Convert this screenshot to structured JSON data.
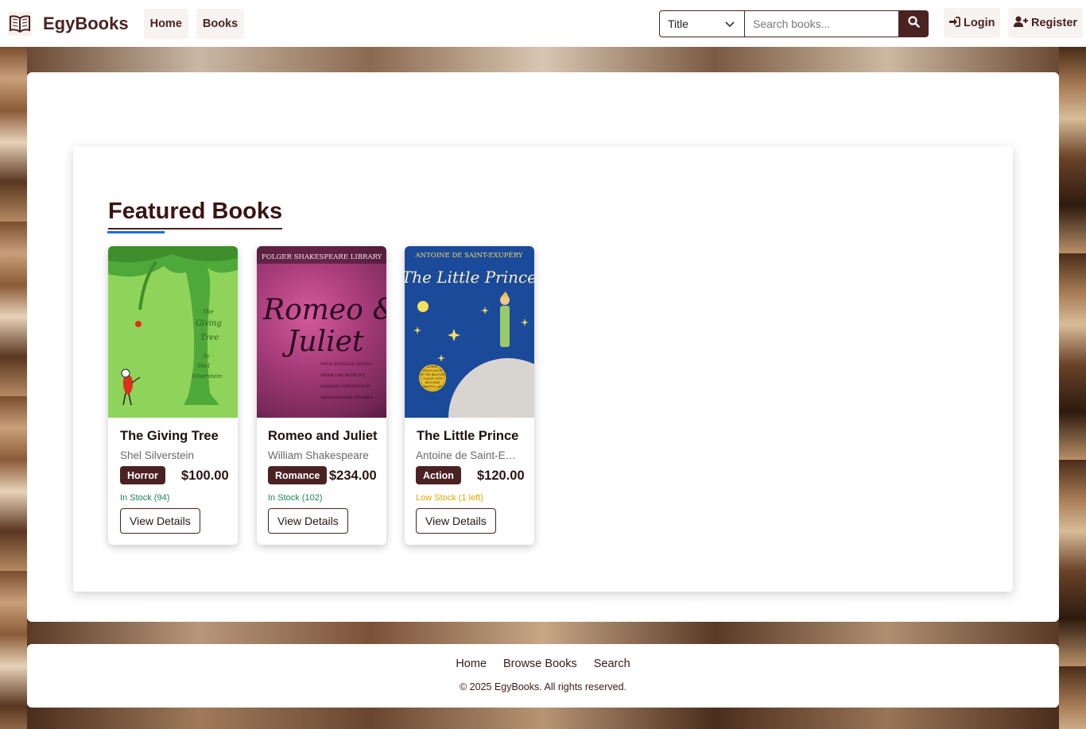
{
  "brand": {
    "name": "EgyBooks",
    "icon": "open-book-icon"
  },
  "nav": {
    "home": "Home",
    "books": "Books"
  },
  "search": {
    "field_selected": "Title",
    "placeholder": "Search books...",
    "icon": "search-icon"
  },
  "auth": {
    "login": "Login",
    "register": "Register",
    "login_icon": "sign-in-icon",
    "register_icon": "user-plus-icon"
  },
  "section": {
    "title": "Featured Books"
  },
  "books": [
    {
      "title": "The Giving Tree",
      "author": "Shel Silverstein",
      "genre": "Horror",
      "price": "$100.00",
      "stock": "In Stock (94)",
      "stock_color": "#198754",
      "action": "View Details"
    },
    {
      "title": "Romeo and Juliet",
      "author": "William Shakespeare",
      "genre": "Romance",
      "price": "$234.00",
      "stock": "In Stock (102)",
      "stock_color": "#198754",
      "action": "View Details"
    },
    {
      "title": "The Little Prince",
      "author": "Antoine de Saint-Exupéry",
      "genre": "Action",
      "price": "$120.00",
      "stock": "Low Stock (1 left)",
      "stock_color": "#e0a800",
      "action": "View Details"
    }
  ],
  "covers": {
    "giving_tree": {
      "lines": [
        "the",
        "Giving",
        "Tree",
        "by",
        "Shel",
        "Silverstein"
      ]
    },
    "romeo": {
      "publisher": "FOLGER SHAKESPEARE LIBRARY",
      "title_line1": "Romeo &",
      "title_line2": "Juliet",
      "notes": [
        "WITH DETAILED NOTES",
        "FROM THE WORLD'S",
        "LEADING CENTER FOR",
        "SHAKESPEARE STUDIES"
      ]
    },
    "prince": {
      "author": "ANTOINE DE SAINT-EXUPÉRY",
      "title": "The Little Prince",
      "seal": [
        "A NEW",
        "TRANSLATION",
        "OF THE BELOVED",
        "CLASSIC WITH",
        "RESTORED",
        "ORIGINAL ART"
      ]
    }
  },
  "footer": {
    "links": [
      "Home",
      "Browse Books",
      "Search"
    ],
    "copyright": "© 2025 EgyBooks. All rights reserved."
  },
  "colors": {
    "primary": "#4b2222",
    "accent_underline": "#1a6dea"
  }
}
